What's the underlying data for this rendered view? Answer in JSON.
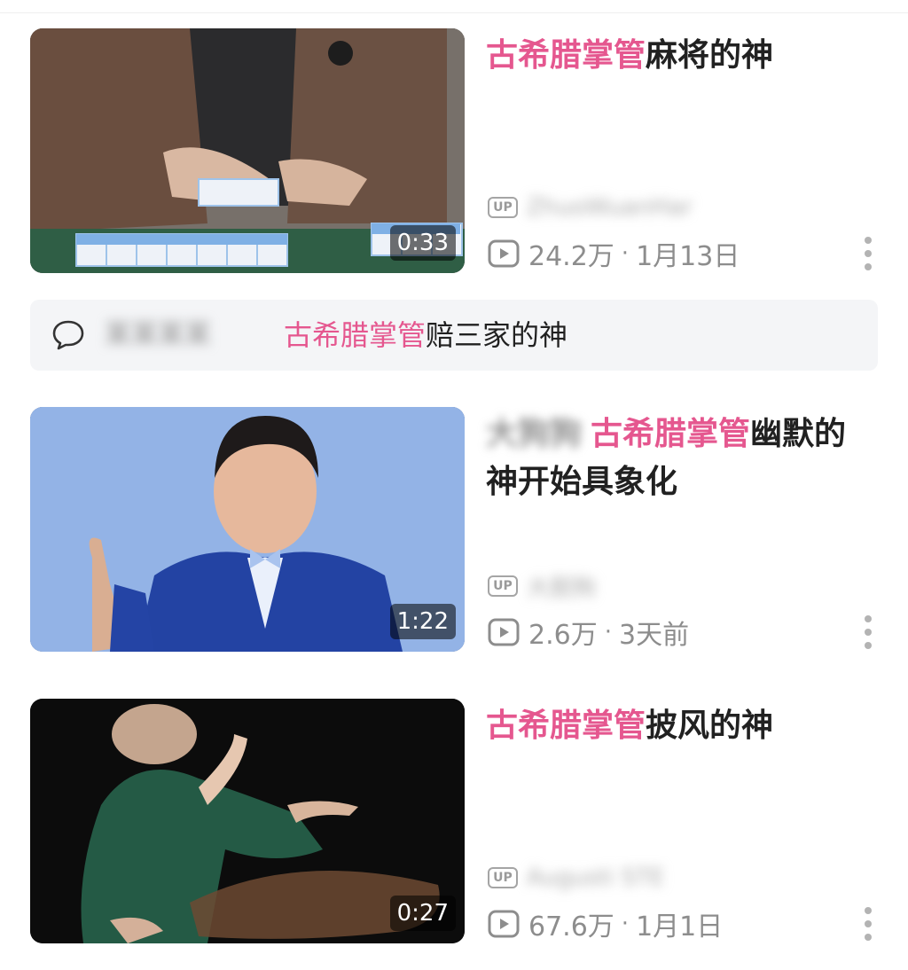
{
  "videos": [
    {
      "highlight": "古希腊掌管",
      "title_rest": "麻将的神",
      "prefix_user": "",
      "duration": "0:33",
      "up_badge": "UP",
      "uploader": "ZhuoWuanHar",
      "views": "24.2万",
      "separator": "·",
      "date": "1月13日"
    },
    {
      "highlight": "古希腊掌管",
      "title_rest": "幽默的神开始具象化",
      "prefix_user": "大狗狗",
      "duration": "1:22",
      "up_badge": "UP",
      "uploader": "大胆狗",
      "views": "2.6万",
      "separator": "·",
      "date": "3天前"
    },
    {
      "highlight": "古希腊掌管",
      "title_rest": "披风的神",
      "prefix_user": "",
      "duration": "0:27",
      "up_badge": "UP",
      "uploader": "Augusti STE",
      "views": "67.6万",
      "separator": "·",
      "date": "1月1日"
    }
  ],
  "comment": {
    "user": "某某某某",
    "highlight": "古希腊掌管",
    "text_rest": "赔三家的神"
  },
  "colors": {
    "highlight": "#e5578f",
    "meta": "#8d8d8d",
    "banner_bg": "#f4f5f7"
  },
  "icons": {
    "play": "play-count-icon",
    "more": "more-vertical-icon",
    "comment": "comment-bubble-icon",
    "up": "up-badge-icon"
  }
}
